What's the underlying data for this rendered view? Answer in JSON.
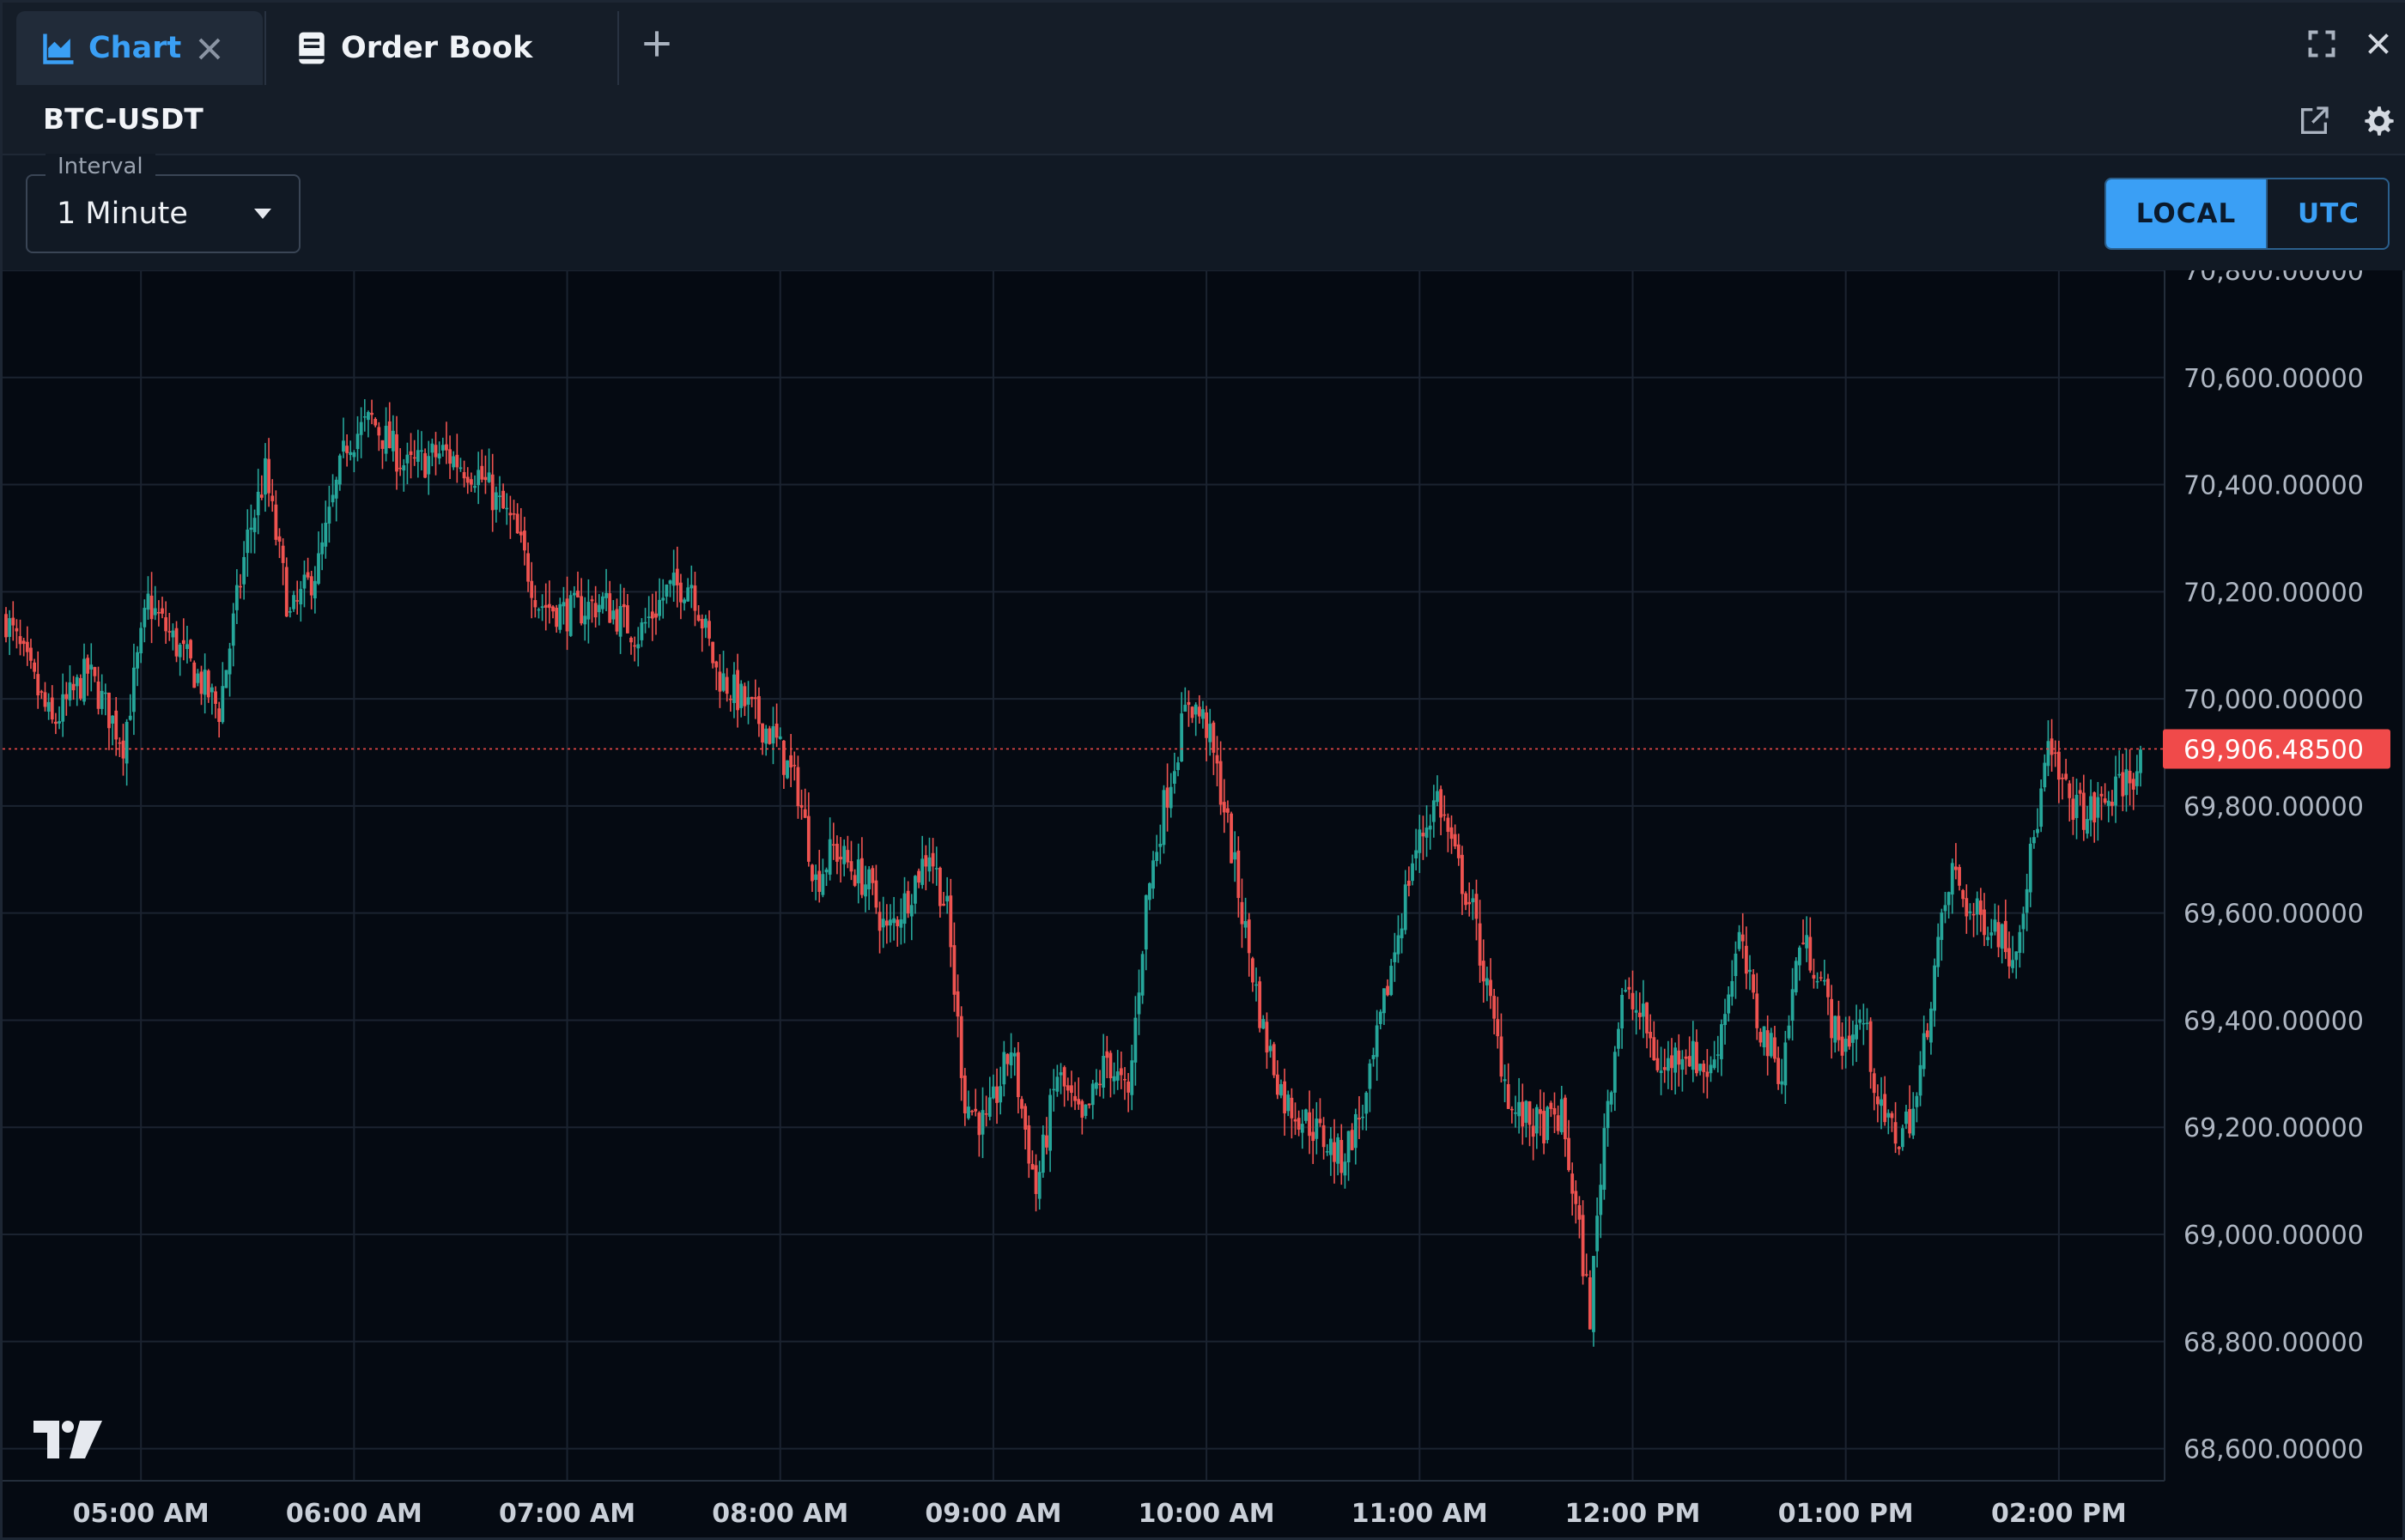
{
  "tabs": [
    {
      "label": "Chart",
      "icon": "area-chart-icon",
      "active": true
    },
    {
      "label": "Order Book",
      "icon": "book-icon",
      "active": false
    }
  ],
  "pair": "BTC-USDT",
  "interval": {
    "legend": "Interval",
    "value": "1 Minute"
  },
  "timezone": {
    "options": [
      "LOCAL",
      "UTC"
    ],
    "selected": "LOCAL"
  },
  "colors": {
    "accent": "#3a9ff5",
    "up": "#26a69a",
    "down": "#ef5350",
    "last_price": "#f04a4a"
  },
  "chart_data": {
    "type": "candlestick",
    "y_ticks": [
      "70,800.00000",
      "70,600.00000",
      "70,400.00000",
      "70,200.00000",
      "70,000.00000",
      "69,800.00000",
      "69,600.00000",
      "69,400.00000",
      "69,200.00000",
      "69,000.00000",
      "68,800.00000",
      "68,600.00000"
    ],
    "y_tick_values": [
      70800,
      70600,
      70400,
      70200,
      70000,
      69800,
      69600,
      69400,
      69200,
      69000,
      68800,
      68600
    ],
    "ylim": [
      68540,
      70800
    ],
    "x_ticks": [
      "05:00 AM",
      "06:00 AM",
      "07:00 AM",
      "08:00 AM",
      "09:00 AM",
      "10:00 AM",
      "11:00 AM",
      "12:00 PM",
      "01:00 PM",
      "02:00 PM"
    ],
    "x_start": "04:22 AM",
    "x_end": "02:23 PM",
    "last_price": 69906.485,
    "last_price_label": "69,906.48500",
    "grid": true,
    "price_path": [
      [
        "04:22 AM",
        70150
      ],
      [
        "04:35 AM",
        69950
      ],
      [
        "04:45 AM",
        70050
      ],
      [
        "04:55 AM",
        69920
      ],
      [
        "05:02 AM",
        70180
      ],
      [
        "05:15 AM",
        70050
      ],
      [
        "05:22 AM",
        69980
      ],
      [
        "05:30 AM",
        70300
      ],
      [
        "05:35 AM",
        70420
      ],
      [
        "05:42 AM",
        70150
      ],
      [
        "05:50 AM",
        70250
      ],
      [
        "05:58 AM",
        70480
      ],
      [
        "06:05 AM",
        70520
      ],
      [
        "06:15 AM",
        70430
      ],
      [
        "06:25 AM",
        70460
      ],
      [
        "06:35 AM",
        70420
      ],
      [
        "06:45 AM",
        70320
      ],
      [
        "06:52 AM",
        70180
      ],
      [
        "07:00 AM",
        70160
      ],
      [
        "07:10 AM",
        70180
      ],
      [
        "07:20 AM",
        70120
      ],
      [
        "07:28 AM",
        70200
      ],
      [
        "07:35 AM",
        70220
      ],
      [
        "07:42 AM",
        70050
      ],
      [
        "07:50 AM",
        69990
      ],
      [
        "07:58 AM",
        69930
      ],
      [
        "08:05 AM",
        69830
      ],
      [
        "08:10 AM",
        69660
      ],
      [
        "08:15 AM",
        69720
      ],
      [
        "08:25 AM",
        69650
      ],
      [
        "08:30 AM",
        69560
      ],
      [
        "08:35 AM",
        69620
      ],
      [
        "08:42 AM",
        69720
      ],
      [
        "08:47 AM",
        69600
      ],
      [
        "08:52 AM",
        69250
      ],
      [
        "08:58 AM",
        69200
      ],
      [
        "09:05 AM",
        69350
      ],
      [
        "09:12 AM",
        69080
      ],
      [
        "09:18 AM",
        69300
      ],
      [
        "09:25 AM",
        69200
      ],
      [
        "09:32 AM",
        69330
      ],
      [
        "09:38 AM",
        69250
      ],
      [
        "09:43 AM",
        69620
      ],
      [
        "09:48 AM",
        69800
      ],
      [
        "09:55 AM",
        70000
      ],
      [
        "10:00 AM",
        69950
      ],
      [
        "10:05 AM",
        69800
      ],
      [
        "10:10 AM",
        69600
      ],
      [
        "10:16 AM",
        69380
      ],
      [
        "10:22 AM",
        69250
      ],
      [
        "10:30 AM",
        69200
      ],
      [
        "10:38 AM",
        69140
      ],
      [
        "10:45 AM",
        69250
      ],
      [
        "10:52 AM",
        69500
      ],
      [
        "10:58 AM",
        69700
      ],
      [
        "11:05 AM",
        69820
      ],
      [
        "11:10 AM",
        69700
      ],
      [
        "11:15 AM",
        69600
      ],
      [
        "11:20 AM",
        69420
      ],
      [
        "11:26 AM",
        69230
      ],
      [
        "11:34 AM",
        69200
      ],
      [
        "11:40 AM",
        69220
      ],
      [
        "11:45 AM",
        69000
      ],
      [
        "11:48 AM",
        68850
      ],
      [
        "11:52 AM",
        69200
      ],
      [
        "11:57 AM",
        69450
      ],
      [
        "12:03 PM",
        69400
      ],
      [
        "12:08 PM",
        69300
      ],
      [
        "12:14 PM",
        69350
      ],
      [
        "12:22 PM",
        69300
      ],
      [
        "12:30 PM",
        69550
      ],
      [
        "12:35 PM",
        69400
      ],
      [
        "12:42 PM",
        69300
      ],
      [
        "12:47 PM",
        69550
      ],
      [
        "12:52 PM",
        69500
      ],
      [
        "12:58 PM",
        69350
      ],
      [
        "01:05 PM",
        69400
      ],
      [
        "01:10 PM",
        69220
      ],
      [
        "01:15 PM",
        69180
      ],
      [
        "01:20 PM",
        69250
      ],
      [
        "01:25 PM",
        69500
      ],
      [
        "01:30 PM",
        69680
      ],
      [
        "01:35 PM",
        69600
      ],
      [
        "01:42 PM",
        69580
      ],
      [
        "01:47 PM",
        69520
      ],
      [
        "01:52 PM",
        69700
      ],
      [
        "01:57 PM",
        69900
      ],
      [
        "02:02 PM",
        69820
      ],
      [
        "02:08 PM",
        69780
      ],
      [
        "02:15 PM",
        69820
      ],
      [
        "02:23 PM",
        69880
      ]
    ]
  }
}
